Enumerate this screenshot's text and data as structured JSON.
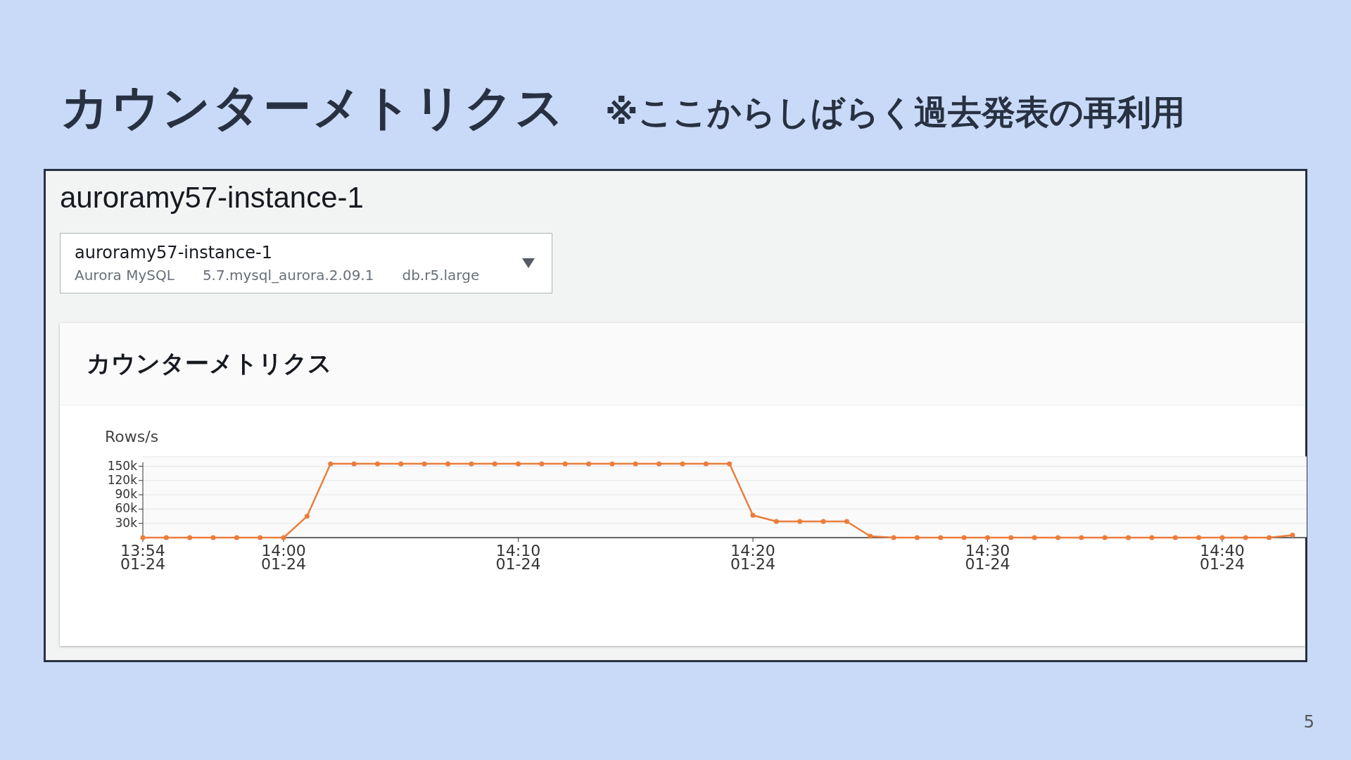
{
  "slide": {
    "title": "カウンターメトリクス",
    "note": "※ここからしばらく過去発表の再利用",
    "page_number": "5"
  },
  "screenshot": {
    "heading": "auroramy57-instance-1",
    "instance_select": {
      "value": "auroramy57-instance-1",
      "details": [
        "Aurora MySQL",
        "5.7.mysql_aurora.2.09.1",
        "db.r5.large"
      ]
    },
    "panel": {
      "title": "カウンターメトリクス",
      "chart_data": {
        "type": "line",
        "ylabel": "Rows/s",
        "categories": [
          "13:54\n01-24",
          null,
          null,
          null,
          null,
          null,
          "14:00\n01-24",
          null,
          null,
          null,
          null,
          null,
          null,
          null,
          null,
          null,
          "14:10\n01-24",
          null,
          null,
          null,
          null,
          null,
          null,
          null,
          null,
          null,
          "14:20\n01-24",
          null,
          null,
          null,
          null,
          null,
          null,
          null,
          null,
          null,
          "14:30\n01-24",
          null,
          null,
          null,
          null,
          null,
          null,
          null,
          null,
          null,
          "14:40\n01-24",
          null,
          null,
          null
        ],
        "grid": true,
        "series": [
          {
            "color": "#eb7d3c",
            "marker": "circle",
            "values": [
              0,
              0,
              0,
              0,
              0,
              0,
              0,
              45000,
              155000,
              155000,
              155000,
              155000,
              155000,
              155000,
              155000,
              155000,
              155000,
              155000,
              155000,
              155000,
              155000,
              155000,
              155000,
              155000,
              155000,
              155000,
              47000,
              34000,
              34000,
              34000,
              34000,
              3000,
              0,
              0,
              0,
              0,
              0,
              0,
              0,
              0,
              0,
              0,
              0,
              0,
              0,
              0,
              0,
              0,
              0,
              5000
            ]
          }
        ],
        "ylim": [
          0,
          170000
        ],
        "yticks": [
          {
            "value": 30000,
            "label": "30k"
          },
          {
            "value": 60000,
            "label": "60k"
          },
          {
            "value": 90000,
            "label": "90k"
          },
          {
            "value": 120000,
            "label": "120k"
          },
          {
            "value": 150000,
            "label": "150k"
          }
        ]
      }
    }
  }
}
